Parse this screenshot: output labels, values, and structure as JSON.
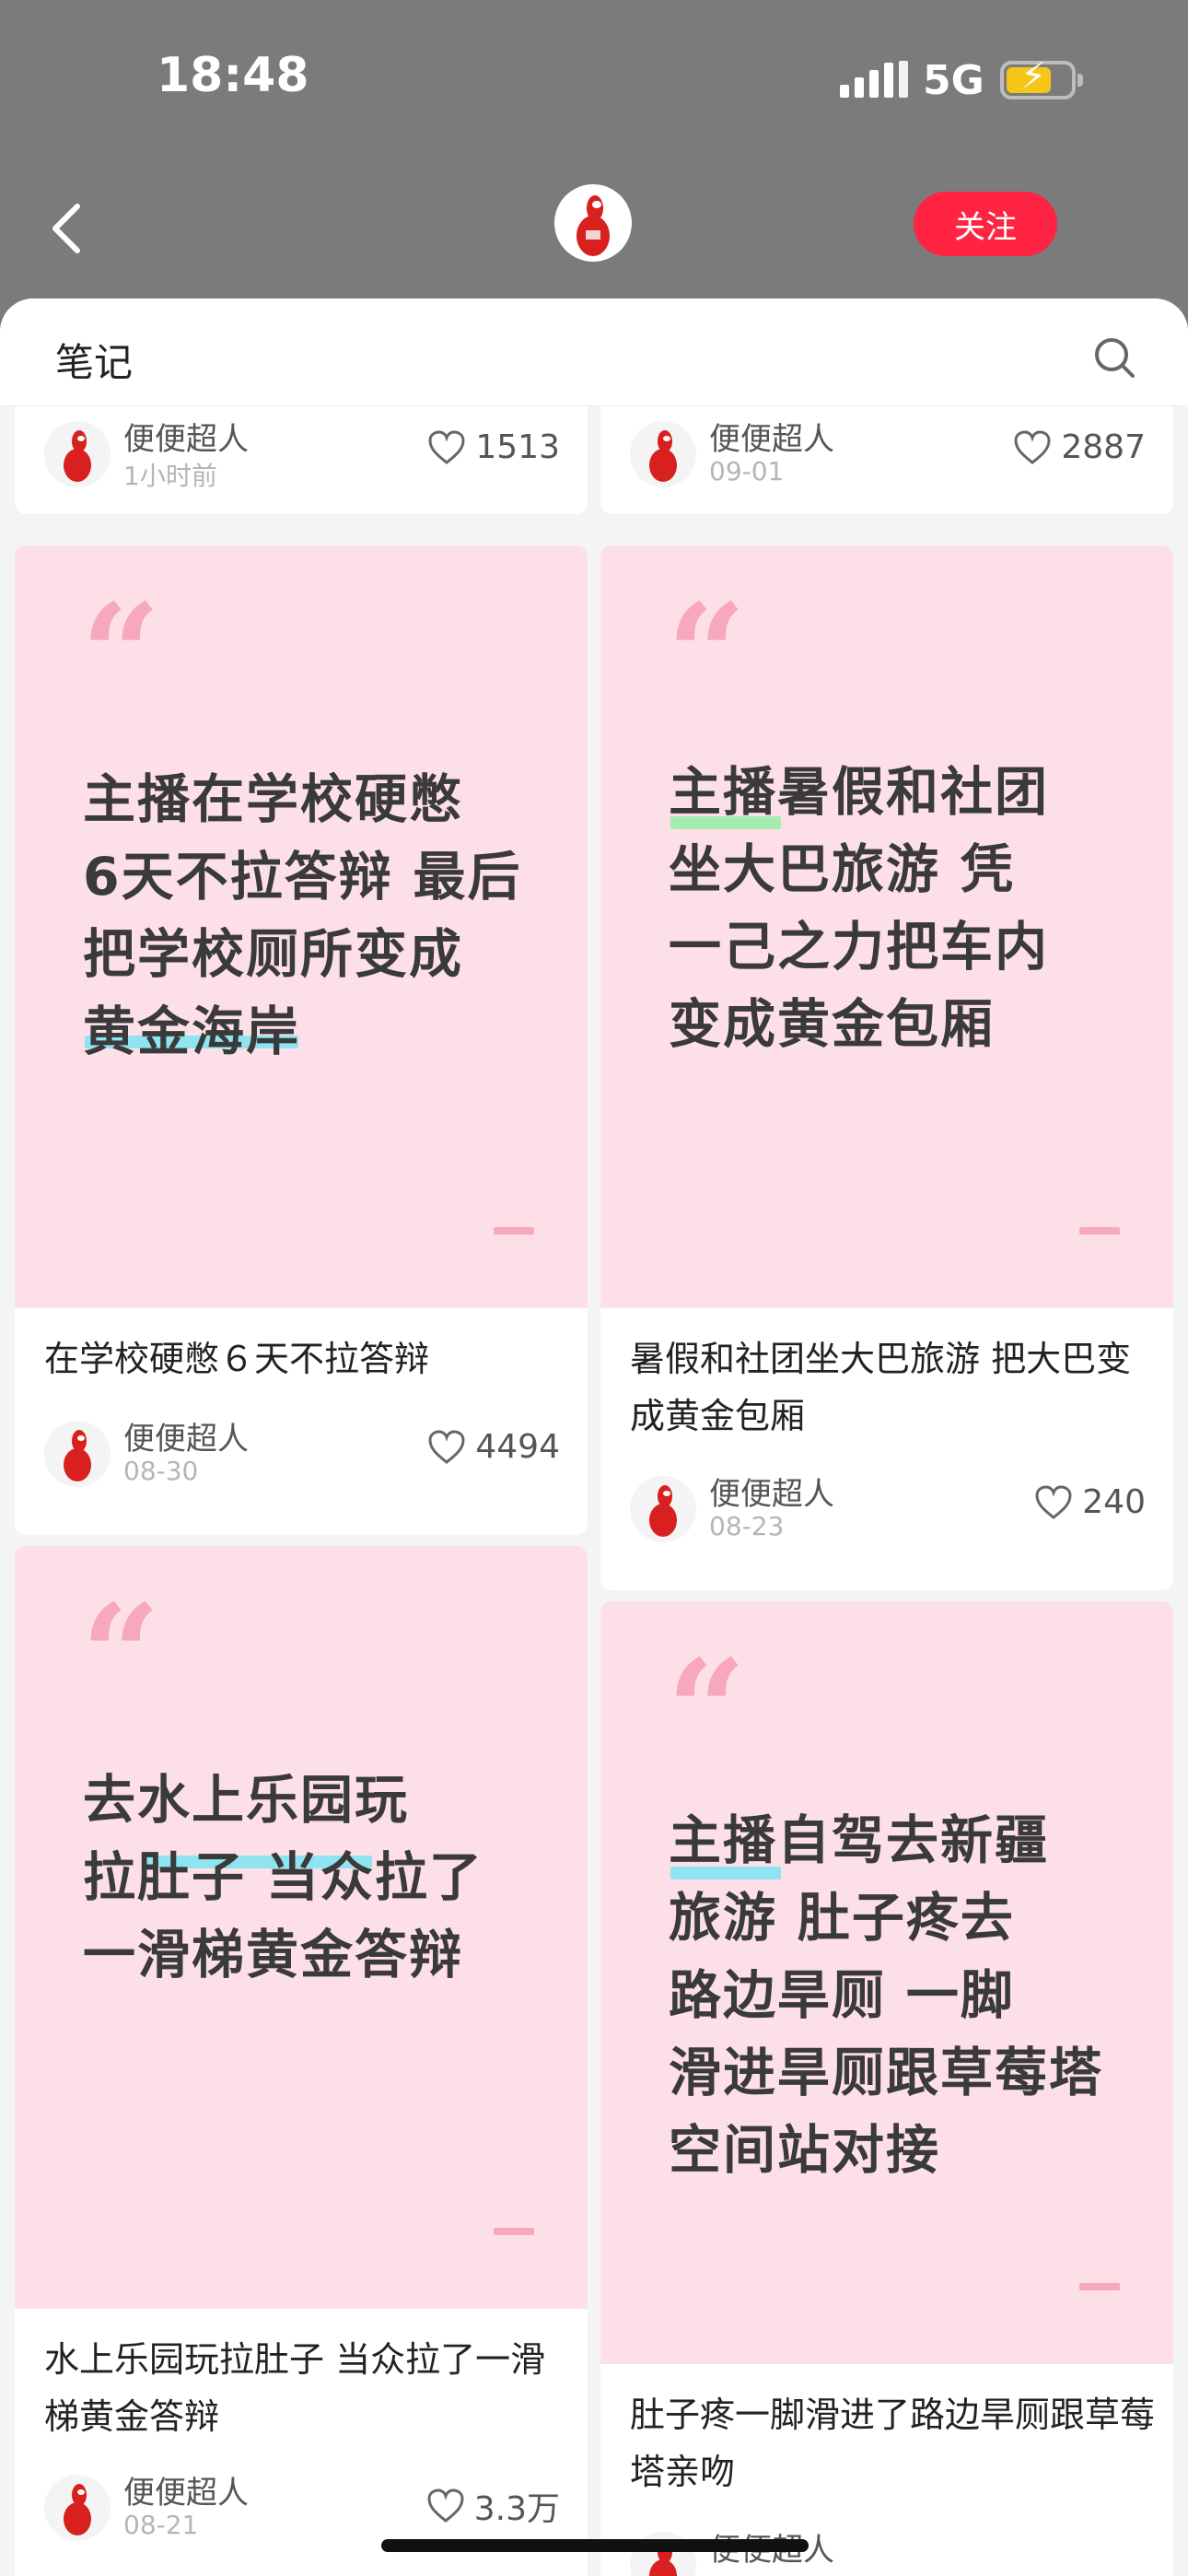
{
  "status_bar": {
    "time": "18:48",
    "network": "5G",
    "battery_charging": true
  },
  "topnav": {
    "follow_label": "关注"
  },
  "section": {
    "title": "笔记"
  },
  "colors": {
    "accent": "#ff2442",
    "cover_bg": "#fde0e7",
    "quote": "#f7a8bb",
    "highlight_blue": "#8fe4f2",
    "highlight_green": "#a6ecb0"
  },
  "icons": [
    "back-icon",
    "avatar",
    "more-icon",
    "search-icon",
    "heart-icon"
  ],
  "top_cards": [
    {
      "author": "便便超人",
      "date": "1小时前",
      "likes": "1513"
    },
    {
      "author": "便便超人",
      "date": "09-01",
      "likes": "2887"
    }
  ],
  "left_cards": [
    {
      "cover_text": [
        "主播在学校硬憋",
        "6天不拉答辩 最后",
        "把学校厕所变成",
        "黄金海岸"
      ],
      "title": "在学校硬憋６天不拉答辩",
      "author": "便便超人",
      "date": "08-30",
      "likes": "4494"
    },
    {
      "cover_text": [
        "去水上乐园玩",
        "拉肚子 当众拉了",
        "一滑梯黄金答辩"
      ],
      "title": "水上乐园玩拉肚子 当众拉了一滑梯黄金答辩",
      "author": "便便超人",
      "date": "08-21",
      "likes": "3.3万"
    }
  ],
  "right_cards": [
    {
      "cover_text": [
        "主播暑假和社团",
        "坐大巴旅游 凭",
        "一己之力把车内",
        "变成黄金包厢"
      ],
      "title": "暑假和社团坐大巴旅游 把大巴变成黄金包厢",
      "author": "便便超人",
      "date": "08-23",
      "likes": "240"
    },
    {
      "cover_text": [
        "主播自驾去新疆",
        "旅游 肚子疼去",
        "路边旱厕 一脚",
        "滑进旱厕跟草莓塔",
        "空间站对接"
      ],
      "title": "肚子疼一脚滑进了路边旱厕跟草莓塔亲吻",
      "author": "便便超人"
    }
  ]
}
